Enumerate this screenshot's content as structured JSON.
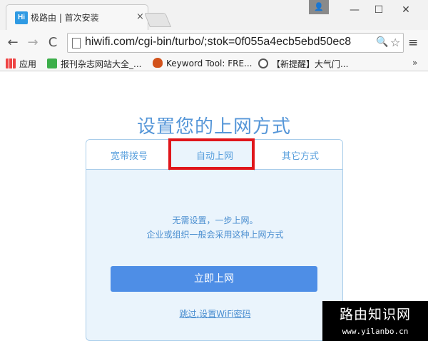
{
  "browser": {
    "tab": {
      "favicon_text": "Hi",
      "title": "极路由 | 首次安装",
      "close_glyph": "×"
    },
    "profile_glyph": "👤",
    "window_controls": {
      "minimize": "—",
      "maximize": "☐",
      "close": "✕"
    },
    "toolbar": {
      "back_glyph": "←",
      "forward_glyph": "→",
      "reload_glyph": "C",
      "url": "hiwifi.com/cgi-bin/turbo/;stok=0f055a4ecb5ebd50ec8",
      "zoom_glyph": "🔍",
      "star_glyph": "☆",
      "menu_glyph": "≡"
    },
    "bookmarks": [
      {
        "label": "应用",
        "icon": "apps-grid-icon"
      },
      {
        "label": "报刊杂志网站大全_...",
        "icon": "green-c-icon"
      },
      {
        "label": "Keyword Tool: FRE...",
        "icon": "flame-icon"
      },
      {
        "label": "【新提醒】大气门...",
        "icon": "wordpress-icon"
      }
    ],
    "bookmarks_more": "»"
  },
  "page": {
    "title": "设置您的上网方式",
    "tabs": [
      {
        "label": "宽带拨号"
      },
      {
        "label": "自动上网",
        "active": true
      },
      {
        "label": "其它方式"
      }
    ],
    "description_line1": "无需设置，一步上网。",
    "description_line2": "企业或组织一般会采用这种上网方式",
    "connect_button": "立即上网",
    "skip_link": "跳过,设置WiFi密码"
  },
  "watermark": {
    "title": "路由知识网",
    "url": "www.yilanbo.cn"
  },
  "colors": {
    "accent": "#4e8ee6",
    "title_blue": "#5596d8",
    "card_bg": "#eaf4fc",
    "highlight_red": "#e0161b"
  }
}
